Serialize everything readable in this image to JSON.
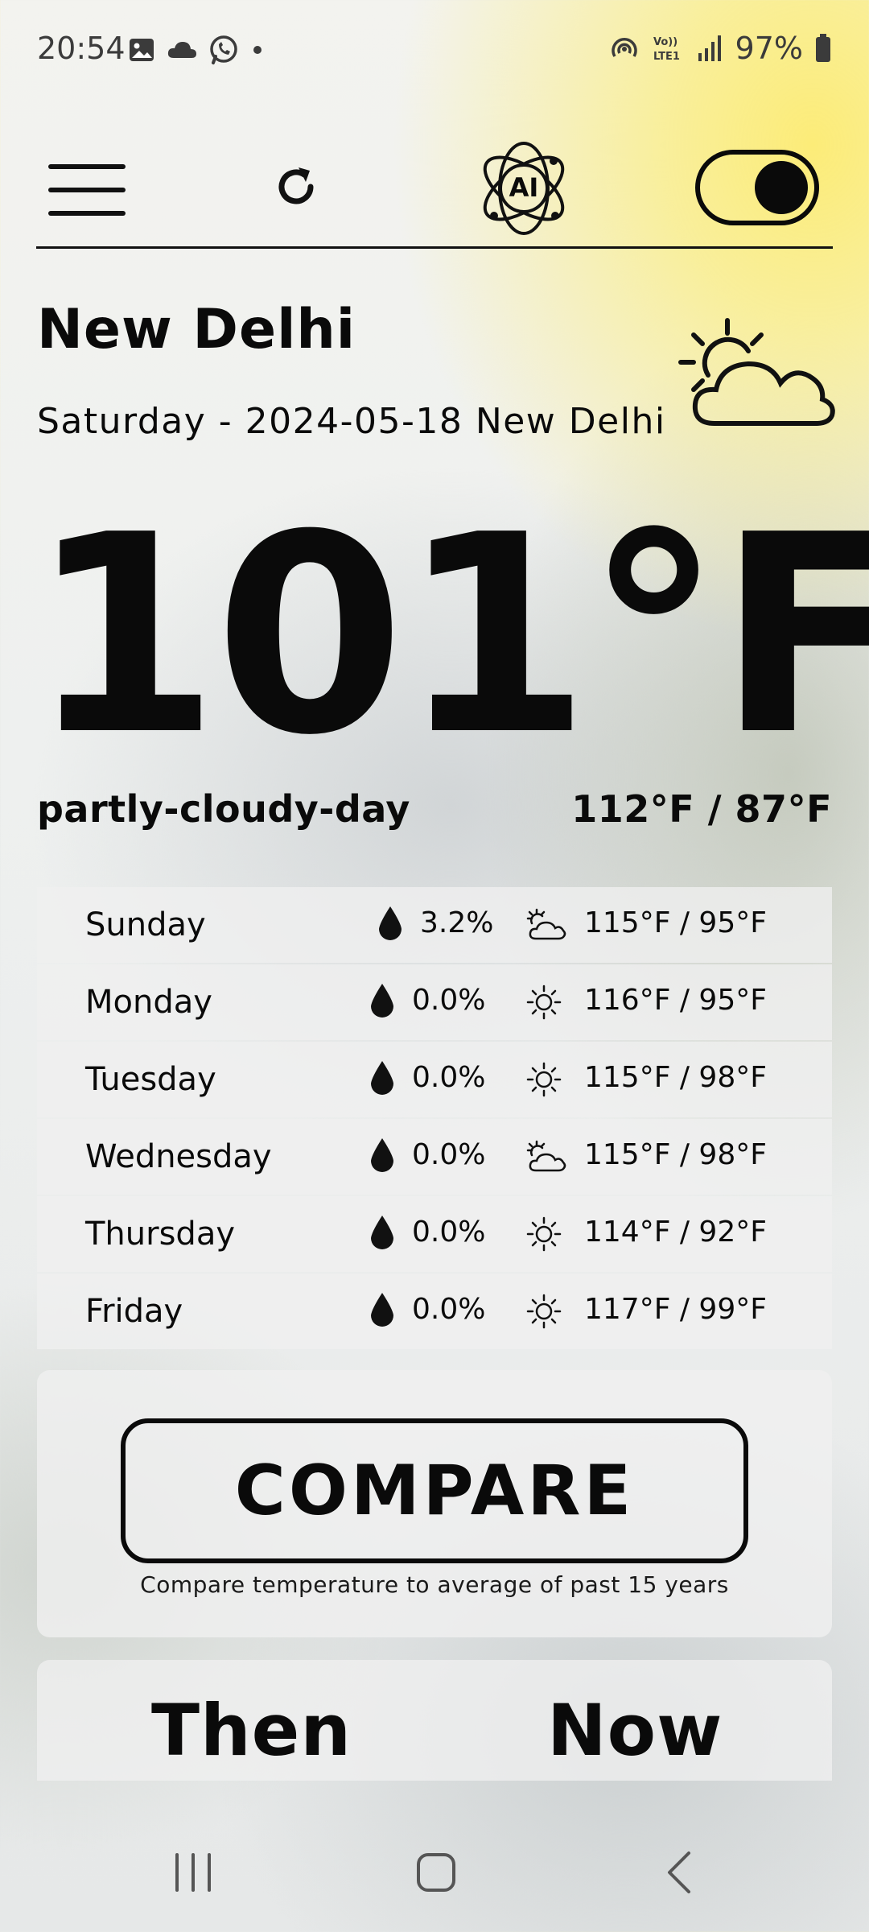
{
  "status_bar": {
    "time": "20:54",
    "battery": "97%",
    "left_icons": [
      "gallery-icon",
      "cloud-icon",
      "whatsapp-icon",
      "dot-icon"
    ],
    "right_icons": [
      "hotspot-icon",
      "volte-icon",
      "signal-icon",
      "battery-icon"
    ],
    "volte_text": "Vo)) LTE1"
  },
  "header": {
    "menu_icon": "hamburger-icon",
    "refresh_icon": "refresh-icon",
    "logo_text": "AI",
    "theme_toggle_on": true
  },
  "location": {
    "city": "New Delhi",
    "date_line": "Saturday - 2024-05-18 New Delhi",
    "condition_icon": "partly-cloudy-day-icon"
  },
  "current": {
    "temperature": "101°F",
    "condition": "partly-cloudy-day",
    "high_low": "112°F / 87°F"
  },
  "forecast": [
    {
      "day": "Sunday",
      "precip": "3.2%",
      "icon": "partly-cloudy-icon",
      "range": "115°F / 95°F"
    },
    {
      "day": "Monday",
      "precip": "0.0%",
      "icon": "sun-icon",
      "range": "116°F / 95°F"
    },
    {
      "day": "Tuesday",
      "precip": "0.0%",
      "icon": "sun-icon",
      "range": "115°F / 98°F"
    },
    {
      "day": "Wednesday",
      "precip": "0.0%",
      "icon": "partly-cloudy-icon",
      "range": "115°F / 98°F"
    },
    {
      "day": "Thursday",
      "precip": "0.0%",
      "icon": "sun-icon",
      "range": "114°F / 92°F"
    },
    {
      "day": "Friday",
      "precip": "0.0%",
      "icon": "sun-icon",
      "range": "117°F / 99°F"
    }
  ],
  "compare": {
    "button_label": "COMPARE",
    "caption": "Compare temperature to average of past 15 years",
    "then_label": "Then",
    "now_label": "Now"
  },
  "colors": {
    "accent_yellow": "#FCEC78",
    "text": "#0A0A0A",
    "card": "#F0F0F0"
  }
}
